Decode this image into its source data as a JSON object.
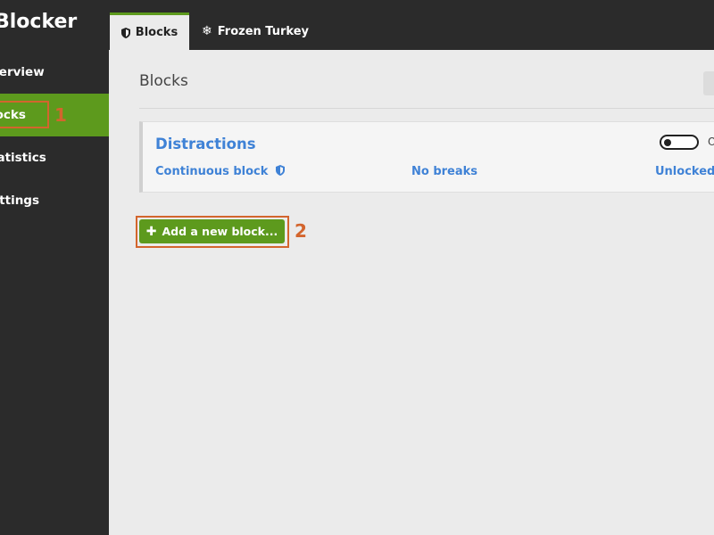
{
  "app": {
    "title": "Blocker"
  },
  "sidebar": {
    "items": [
      {
        "label": "Overview",
        "visible": "verview",
        "active": false
      },
      {
        "label": "Blocks",
        "visible": "locks",
        "active": true
      },
      {
        "label": "Statistics",
        "visible": "tatistics",
        "active": false
      },
      {
        "label": "Settings",
        "visible": "ettings",
        "active": false
      }
    ]
  },
  "tabs": [
    {
      "label": "Blocks",
      "icon": "shield-icon",
      "active": true
    },
    {
      "label": "Frozen Turkey",
      "icon": "snowflake-icon",
      "active": false
    }
  ],
  "main": {
    "title": "Blocks",
    "blocks": [
      {
        "name": "Distractions",
        "type_label": "Continuous block",
        "type_icon": "shield-icon",
        "breaks_label": "No breaks",
        "lock_label": "Unlocked",
        "toggle_on": false,
        "toggle_label": "O"
      }
    ],
    "add_button_label": "Add a new block..."
  },
  "annotations": [
    {
      "number": "1",
      "target": "Blocks sidebar item"
    },
    {
      "number": "2",
      "target": "Add a new block button"
    }
  ],
  "colors": {
    "sidebar_bg": "#2b2b2b",
    "accent_green": "#5d9a1d",
    "link_blue": "#3f82d6",
    "annotation_orange": "#d3652d",
    "content_bg": "#ebebeb"
  }
}
